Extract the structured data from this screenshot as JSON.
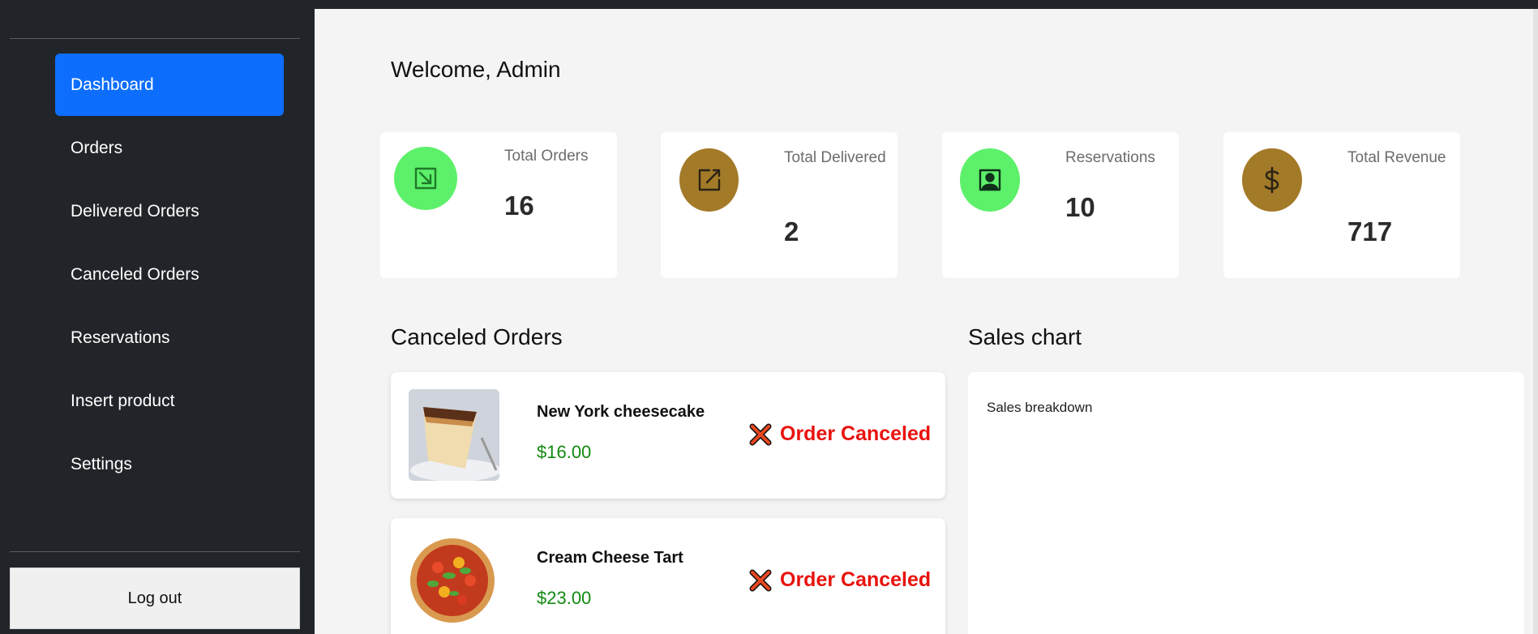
{
  "sidebar": {
    "items": [
      {
        "label": "Dashboard",
        "active": true
      },
      {
        "label": "Orders"
      },
      {
        "label": "Delivered Orders"
      },
      {
        "label": "Canceled Orders"
      },
      {
        "label": "Reservations"
      },
      {
        "label": "Insert product"
      },
      {
        "label": "Settings"
      }
    ],
    "logout_label": "Log out"
  },
  "main": {
    "welcome": "Welcome, Admin",
    "stats": [
      {
        "label": "Total Orders",
        "value": "16",
        "icon": "import-arrow-icon",
        "icon_bg": "#5df06a"
      },
      {
        "label": "Total Delivered",
        "value": "2",
        "icon": "edit-square-icon",
        "icon_bg": "#a37a28"
      },
      {
        "label": "Reservations",
        "value": "10",
        "icon": "person-square-icon",
        "icon_bg": "#5df06a"
      },
      {
        "label": "Total Revenue",
        "value": "717",
        "icon": "dollar-icon",
        "icon_bg": "#a37a28"
      }
    ],
    "canceled_title": "Canceled Orders",
    "orders": [
      {
        "name": "New York cheesecake",
        "price": "$16.00",
        "status": "Order Canceled",
        "image": "cheesecake-image"
      },
      {
        "name": "Cream Cheese Tart",
        "price": "$23.00",
        "status": "Order Canceled",
        "image": "tart-image"
      }
    ],
    "sales_title": "Sales chart",
    "sales_subtitle": "Sales breakdown"
  },
  "colors": {
    "sidebar_bg": "#212529",
    "active": "#0d6efd",
    "canceled": "#e8130e",
    "price": "#128a12"
  }
}
